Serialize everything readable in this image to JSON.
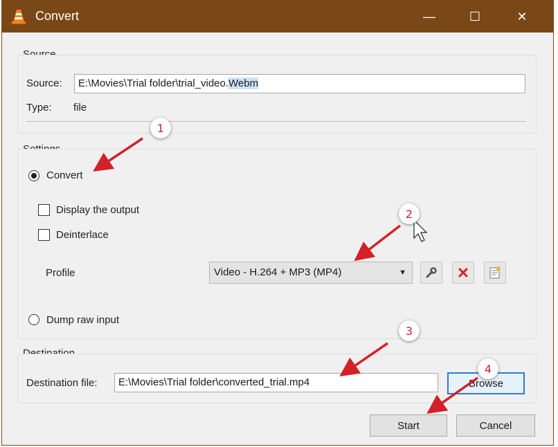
{
  "window": {
    "title": "Convert",
    "controls": {
      "minimize": "—",
      "maximize": "☐",
      "close": "✕"
    },
    "titlebar_color": "#7a4716"
  },
  "source": {
    "group_title": "Source",
    "source_label": "Source:",
    "path_prefix": "E:\\Movies\\Trial folder\\trial_video.",
    "path_highlight": "Webm",
    "type_label": "Type:",
    "type_value": "file"
  },
  "settings": {
    "group_title": "Settings",
    "convert_label": "Convert",
    "convert_selected": true,
    "display_output_label": "Display the output",
    "display_output_checked": false,
    "deinterlace_label": "Deinterlace",
    "deinterlace_checked": false,
    "profile_label": "Profile",
    "profile_value": "Video - H.264 + MP3 (MP4)",
    "profile_buttons": [
      "wrench-icon",
      "delete-red-x-icon",
      "new-profile-icon"
    ],
    "dump_raw_label": "Dump raw input",
    "dump_raw_selected": false
  },
  "destination": {
    "group_title": "Destination",
    "file_label": "Destination file:",
    "file_value": "E:\\Movies\\Trial folder\\converted_trial.mp4",
    "browse_label": "Browse"
  },
  "footer": {
    "start_label": "Start",
    "cancel_label": "Cancel"
  },
  "annotations": {
    "step_1": "1",
    "step_2": "2",
    "step_3": "3",
    "step_4": "4",
    "arrow_color": "#d42027"
  }
}
